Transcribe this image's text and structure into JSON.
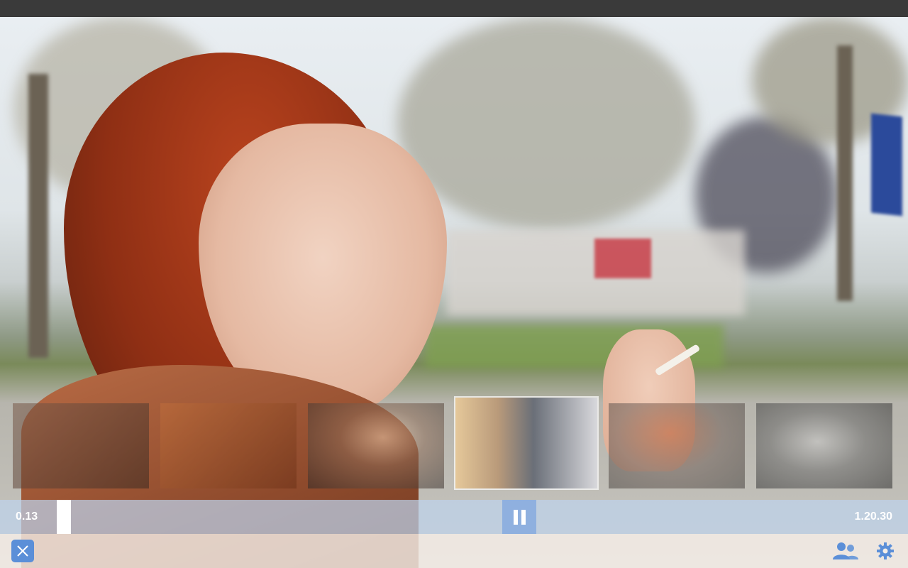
{
  "player": {
    "time_current": "0.13",
    "time_total": "1.20.30",
    "progress_fraction": 0.5,
    "is_playing": true
  },
  "thumbnails": {
    "count_visible": 6,
    "active_index": 3
  },
  "toolbar": {
    "close_icon": "close-icon",
    "people_icon": "people-icon",
    "settings_icon": "gear-icon"
  },
  "colors": {
    "accent": "#5b8fd8",
    "pause_button": "#8fb0df",
    "progress_track": "#bed2eb",
    "topbar": "#3a3a3a"
  }
}
